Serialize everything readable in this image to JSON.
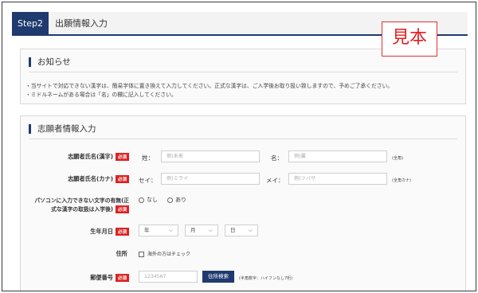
{
  "step": {
    "badge": "Step2",
    "title": "出願情報入力"
  },
  "stamp": "見本",
  "notice": {
    "heading": "お知らせ",
    "lines": [
      "・当サイトで対応できない漢字は、簡易字体に置き換えて入力してください。正式な漢字は、ご入学後お取り扱い致しますので、予めご了承ください。",
      "・ミドルネームがある場合は「名」の欄に記入してください。"
    ]
  },
  "form": {
    "heading": "志願者情報入力",
    "required_label": "必須",
    "name_kanji": {
      "label": "志願者氏名(漢字)",
      "sei_label": "姓：",
      "sei_placeholder": "例)未来",
      "mei_label": "名：",
      "mei_placeholder": "例)翼",
      "hint": "(全角)"
    },
    "name_kana": {
      "label": "志願者氏名(カナ)",
      "sei_label": "セイ：",
      "sei_placeholder": "例)ミライ",
      "mei_label": "メイ：",
      "mei_placeholder": "例)ツバサ",
      "hint": "(全角カナ)"
    },
    "unsupported_chars": {
      "label_line1": "パソコンに入力できない文字の有無(正",
      "label_line2": "式な漢字の取扱は入学後)",
      "option_none": "なし",
      "option_some": "あり"
    },
    "birthdate": {
      "label": "生年月日",
      "year": "年",
      "month": "月",
      "day": "日"
    },
    "address": {
      "label": "住所",
      "overseas_check": "海外の方はチェック"
    },
    "postal": {
      "label": "郵便番号",
      "placeholder": "1234567",
      "search_button": "住所検索",
      "hint": "(半角数字：ハイフンなし7桁)"
    }
  }
}
